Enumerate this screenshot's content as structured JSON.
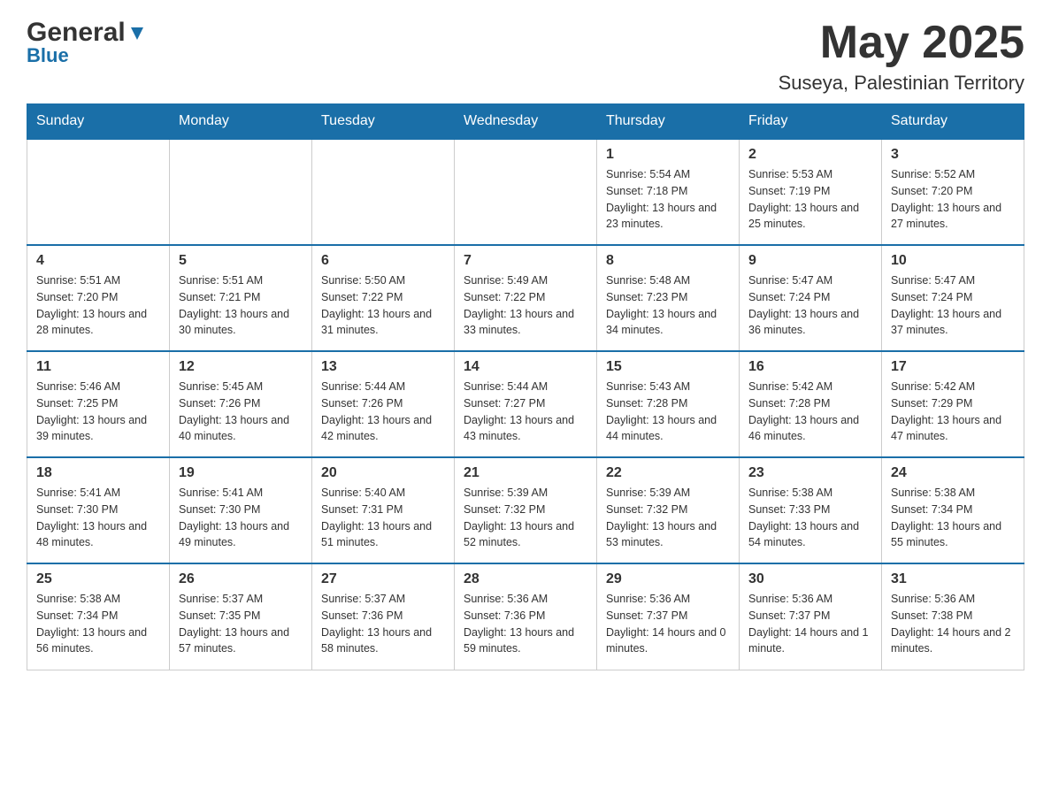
{
  "header": {
    "logo_general": "General",
    "logo_blue": "Blue",
    "month": "May 2025",
    "location": "Suseya, Palestinian Territory"
  },
  "weekdays": [
    "Sunday",
    "Monday",
    "Tuesday",
    "Wednesday",
    "Thursday",
    "Friday",
    "Saturday"
  ],
  "weeks": [
    [
      {
        "day": "",
        "sunrise": "",
        "sunset": "",
        "daylight": ""
      },
      {
        "day": "",
        "sunrise": "",
        "sunset": "",
        "daylight": ""
      },
      {
        "day": "",
        "sunrise": "",
        "sunset": "",
        "daylight": ""
      },
      {
        "day": "",
        "sunrise": "",
        "sunset": "",
        "daylight": ""
      },
      {
        "day": "1",
        "sunrise": "Sunrise: 5:54 AM",
        "sunset": "Sunset: 7:18 PM",
        "daylight": "Daylight: 13 hours and 23 minutes."
      },
      {
        "day": "2",
        "sunrise": "Sunrise: 5:53 AM",
        "sunset": "Sunset: 7:19 PM",
        "daylight": "Daylight: 13 hours and 25 minutes."
      },
      {
        "day": "3",
        "sunrise": "Sunrise: 5:52 AM",
        "sunset": "Sunset: 7:20 PM",
        "daylight": "Daylight: 13 hours and 27 minutes."
      }
    ],
    [
      {
        "day": "4",
        "sunrise": "Sunrise: 5:51 AM",
        "sunset": "Sunset: 7:20 PM",
        "daylight": "Daylight: 13 hours and 28 minutes."
      },
      {
        "day": "5",
        "sunrise": "Sunrise: 5:51 AM",
        "sunset": "Sunset: 7:21 PM",
        "daylight": "Daylight: 13 hours and 30 minutes."
      },
      {
        "day": "6",
        "sunrise": "Sunrise: 5:50 AM",
        "sunset": "Sunset: 7:22 PM",
        "daylight": "Daylight: 13 hours and 31 minutes."
      },
      {
        "day": "7",
        "sunrise": "Sunrise: 5:49 AM",
        "sunset": "Sunset: 7:22 PM",
        "daylight": "Daylight: 13 hours and 33 minutes."
      },
      {
        "day": "8",
        "sunrise": "Sunrise: 5:48 AM",
        "sunset": "Sunset: 7:23 PM",
        "daylight": "Daylight: 13 hours and 34 minutes."
      },
      {
        "day": "9",
        "sunrise": "Sunrise: 5:47 AM",
        "sunset": "Sunset: 7:24 PM",
        "daylight": "Daylight: 13 hours and 36 minutes."
      },
      {
        "day": "10",
        "sunrise": "Sunrise: 5:47 AM",
        "sunset": "Sunset: 7:24 PM",
        "daylight": "Daylight: 13 hours and 37 minutes."
      }
    ],
    [
      {
        "day": "11",
        "sunrise": "Sunrise: 5:46 AM",
        "sunset": "Sunset: 7:25 PM",
        "daylight": "Daylight: 13 hours and 39 minutes."
      },
      {
        "day": "12",
        "sunrise": "Sunrise: 5:45 AM",
        "sunset": "Sunset: 7:26 PM",
        "daylight": "Daylight: 13 hours and 40 minutes."
      },
      {
        "day": "13",
        "sunrise": "Sunrise: 5:44 AM",
        "sunset": "Sunset: 7:26 PM",
        "daylight": "Daylight: 13 hours and 42 minutes."
      },
      {
        "day": "14",
        "sunrise": "Sunrise: 5:44 AM",
        "sunset": "Sunset: 7:27 PM",
        "daylight": "Daylight: 13 hours and 43 minutes."
      },
      {
        "day": "15",
        "sunrise": "Sunrise: 5:43 AM",
        "sunset": "Sunset: 7:28 PM",
        "daylight": "Daylight: 13 hours and 44 minutes."
      },
      {
        "day": "16",
        "sunrise": "Sunrise: 5:42 AM",
        "sunset": "Sunset: 7:28 PM",
        "daylight": "Daylight: 13 hours and 46 minutes."
      },
      {
        "day": "17",
        "sunrise": "Sunrise: 5:42 AM",
        "sunset": "Sunset: 7:29 PM",
        "daylight": "Daylight: 13 hours and 47 minutes."
      }
    ],
    [
      {
        "day": "18",
        "sunrise": "Sunrise: 5:41 AM",
        "sunset": "Sunset: 7:30 PM",
        "daylight": "Daylight: 13 hours and 48 minutes."
      },
      {
        "day": "19",
        "sunrise": "Sunrise: 5:41 AM",
        "sunset": "Sunset: 7:30 PM",
        "daylight": "Daylight: 13 hours and 49 minutes."
      },
      {
        "day": "20",
        "sunrise": "Sunrise: 5:40 AM",
        "sunset": "Sunset: 7:31 PM",
        "daylight": "Daylight: 13 hours and 51 minutes."
      },
      {
        "day": "21",
        "sunrise": "Sunrise: 5:39 AM",
        "sunset": "Sunset: 7:32 PM",
        "daylight": "Daylight: 13 hours and 52 minutes."
      },
      {
        "day": "22",
        "sunrise": "Sunrise: 5:39 AM",
        "sunset": "Sunset: 7:32 PM",
        "daylight": "Daylight: 13 hours and 53 minutes."
      },
      {
        "day": "23",
        "sunrise": "Sunrise: 5:38 AM",
        "sunset": "Sunset: 7:33 PM",
        "daylight": "Daylight: 13 hours and 54 minutes."
      },
      {
        "day": "24",
        "sunrise": "Sunrise: 5:38 AM",
        "sunset": "Sunset: 7:34 PM",
        "daylight": "Daylight: 13 hours and 55 minutes."
      }
    ],
    [
      {
        "day": "25",
        "sunrise": "Sunrise: 5:38 AM",
        "sunset": "Sunset: 7:34 PM",
        "daylight": "Daylight: 13 hours and 56 minutes."
      },
      {
        "day": "26",
        "sunrise": "Sunrise: 5:37 AM",
        "sunset": "Sunset: 7:35 PM",
        "daylight": "Daylight: 13 hours and 57 minutes."
      },
      {
        "day": "27",
        "sunrise": "Sunrise: 5:37 AM",
        "sunset": "Sunset: 7:36 PM",
        "daylight": "Daylight: 13 hours and 58 minutes."
      },
      {
        "day": "28",
        "sunrise": "Sunrise: 5:36 AM",
        "sunset": "Sunset: 7:36 PM",
        "daylight": "Daylight: 13 hours and 59 minutes."
      },
      {
        "day": "29",
        "sunrise": "Sunrise: 5:36 AM",
        "sunset": "Sunset: 7:37 PM",
        "daylight": "Daylight: 14 hours and 0 minutes."
      },
      {
        "day": "30",
        "sunrise": "Sunrise: 5:36 AM",
        "sunset": "Sunset: 7:37 PM",
        "daylight": "Daylight: 14 hours and 1 minute."
      },
      {
        "day": "31",
        "sunrise": "Sunrise: 5:36 AM",
        "sunset": "Sunset: 7:38 PM",
        "daylight": "Daylight: 14 hours and 2 minutes."
      }
    ]
  ]
}
